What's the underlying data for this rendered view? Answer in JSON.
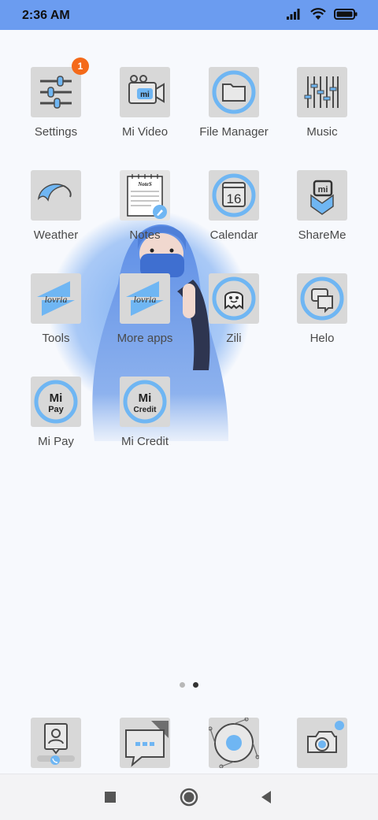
{
  "status_bar": {
    "time": "2:36 AM",
    "icons": [
      "signal-icon",
      "wifi-icon",
      "battery-icon"
    ]
  },
  "apps": [
    {
      "label": "Settings",
      "icon": "settings-icon",
      "badge": "1"
    },
    {
      "label": "Mi Video",
      "icon": "video-camera-icon",
      "icon_text": "mi"
    },
    {
      "label": "File Manager",
      "icon": "folder-icon"
    },
    {
      "label": "Music",
      "icon": "equalizer-icon"
    },
    {
      "label": "Weather",
      "icon": "umbrella-icon"
    },
    {
      "label": "Notes",
      "icon": "notes-icon",
      "icon_text": "NoteS"
    },
    {
      "label": "Calendar",
      "icon": "calendar-icon",
      "icon_text": "16"
    },
    {
      "label": "ShareMe",
      "icon": "shareme-icon",
      "icon_text": "mi"
    },
    {
      "label": "Tools",
      "icon": "lovria-icon",
      "icon_text": "lovria"
    },
    {
      "label": "More apps",
      "icon": "lovria-icon",
      "icon_text": "lovria"
    },
    {
      "label": "Zili",
      "icon": "zili-icon"
    },
    {
      "label": "Helo",
      "icon": "chat-bubbles-icon"
    },
    {
      "label": "Mi Pay",
      "icon": "mi-pay-icon",
      "icon_text": "Pay"
    },
    {
      "label": "Mi Credit",
      "icon": "mi-credit-icon",
      "icon_text": "Credit"
    }
  ],
  "page_indicator": {
    "count": 2,
    "active": 2
  },
  "dock": [
    {
      "icon": "phone-contacts-icon"
    },
    {
      "icon": "messages-icon"
    },
    {
      "icon": "browser-icon"
    },
    {
      "icon": "camera-icon"
    }
  ],
  "navigation": [
    "recents-button",
    "home-button",
    "back-button"
  ],
  "colors": {
    "status_bar": "#6b9cf0",
    "accent": "#6fb6f3",
    "badge": "#f46a1a",
    "tile": "#d8d8d8",
    "label": "#4a4a4a"
  }
}
